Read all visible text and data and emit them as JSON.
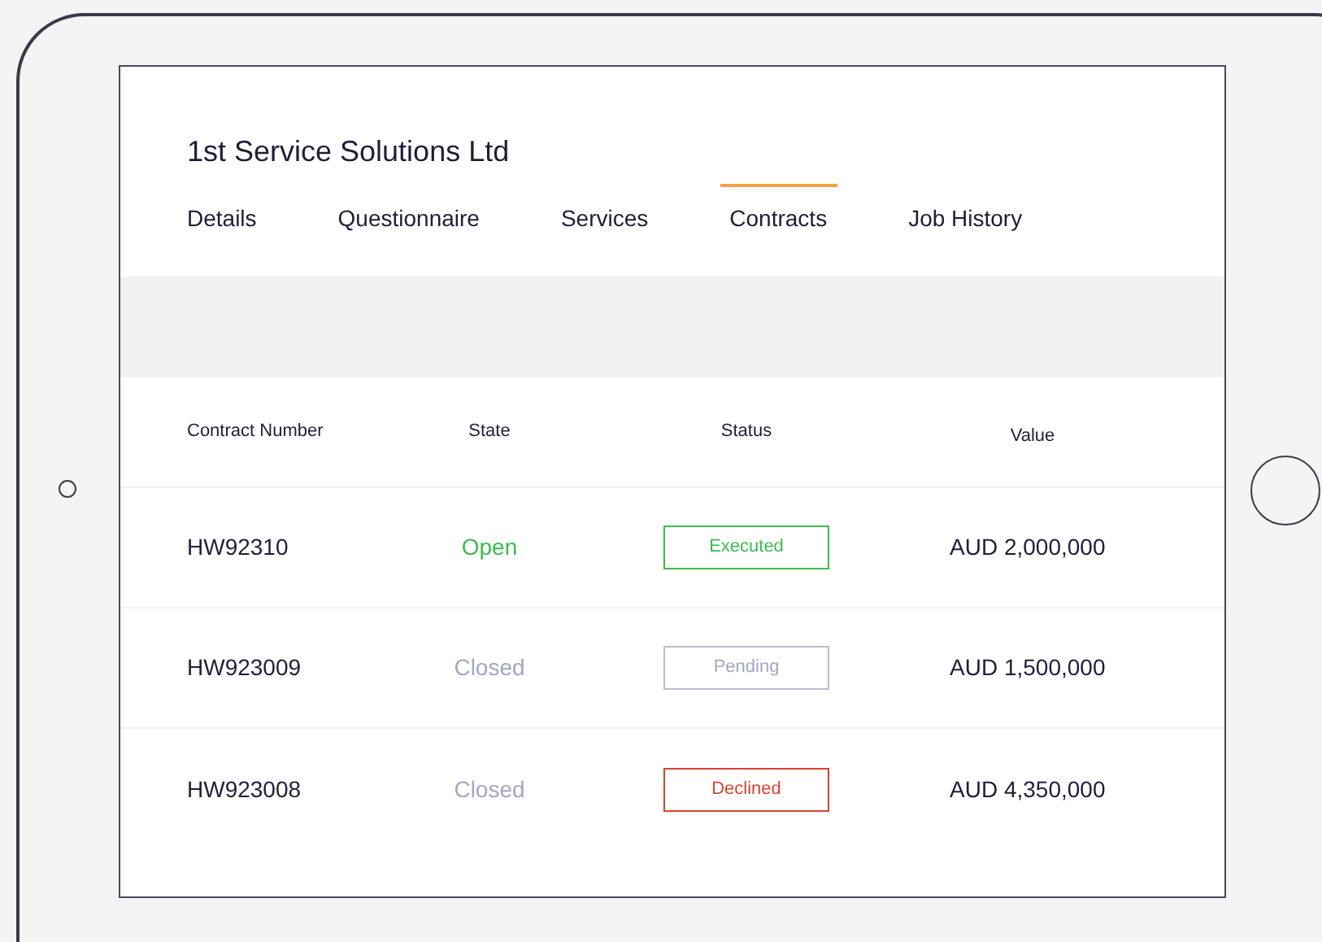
{
  "company": {
    "title": "1st Service Solutions Ltd"
  },
  "tabs": [
    {
      "label": "Details",
      "selected": false
    },
    {
      "label": "Questionnaire",
      "selected": false
    },
    {
      "label": "Services",
      "selected": false
    },
    {
      "label": "Contracts",
      "selected": true
    },
    {
      "label": "Job History",
      "selected": false
    }
  ],
  "table": {
    "columns": [
      "Contract Number",
      "State",
      "Status",
      "Value"
    ],
    "rows": [
      {
        "contract_number": "HW92310",
        "state": {
          "text": "Open",
          "kind": "open"
        },
        "status": {
          "text": "Executed",
          "kind": "executed"
        },
        "value": "AUD 2,000,000"
      },
      {
        "contract_number": "HW923009",
        "state": {
          "text": "Closed",
          "kind": "closed"
        },
        "status": {
          "text": "Pending",
          "kind": "pending"
        },
        "value": "AUD 1,500,000"
      },
      {
        "contract_number": "HW923008",
        "state": {
          "text": "Closed",
          "kind": "closed"
        },
        "status": {
          "text": "Declined",
          "kind": "declined"
        },
        "value": "AUD 4,350,000"
      }
    ]
  }
}
